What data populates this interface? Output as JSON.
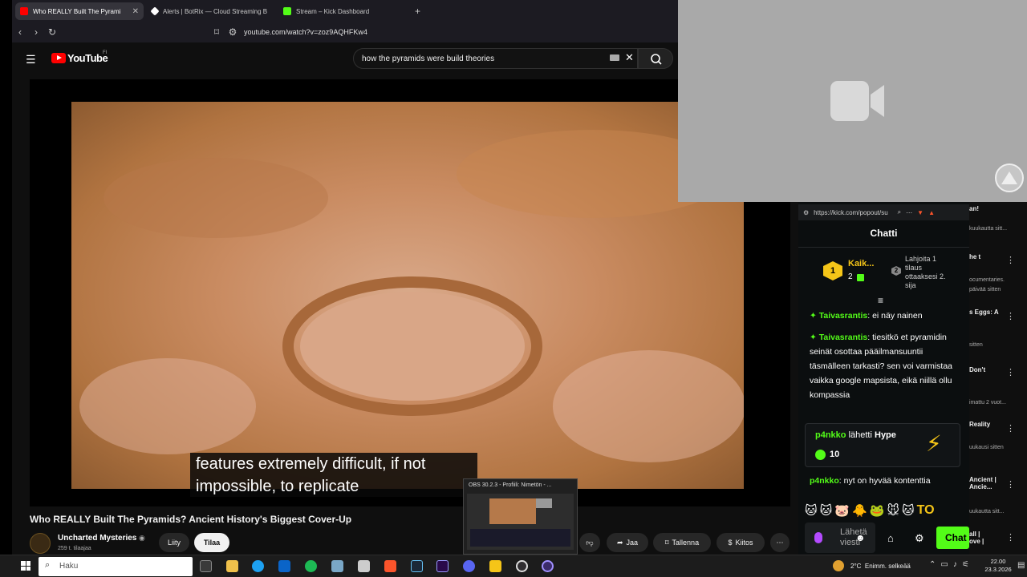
{
  "browser": {
    "tabs": [
      {
        "label": "Who REALLY Built The Pyrami",
        "active": true,
        "color": "#ff0000"
      },
      {
        "label": "Alerts | BotRix — Cloud Streaming B",
        "active": false,
        "color": "#ffffff"
      },
      {
        "label": "Stream – Kick Dashboard",
        "active": false,
        "color": "#53fc18"
      }
    ],
    "new_tab": "+",
    "url": "youtube.com/watch?v=zoz9AQHFKw4"
  },
  "youtube": {
    "logo": "YouTube",
    "region": "FI",
    "search_value": "how the pyramids were build theories",
    "caption_line1": "features extremely difficult, if not",
    "caption_line2": "impossible, to replicate",
    "video_title": "Who REALLY Built The Pyramids? Ancient History's Biggest Cover-Up",
    "channel_name": "Uncharted Mysteries",
    "subscribers": "259 t. tilaajaa",
    "join_label": "Liity",
    "subscribe_label": "Tilaa",
    "share_label": "Jaa",
    "save_label": "Tallenna",
    "thanks_label": "Kiitos",
    "more_label": "⋯"
  },
  "kick": {
    "url": "https://kick.com/popout/su",
    "title": "Chatti",
    "leader_name": "Kaik...",
    "leader_count": "2",
    "leader_rank": "1",
    "gift_rank": "2",
    "gift_text": "Lahjoita 1 tilaus ottaaksesi 2. sija",
    "messages": [
      {
        "user": "Taivasrantis",
        "text": "ei näy nainen"
      },
      {
        "user": "Taivasrantis",
        "text": "tiesitkö et pyramidin seinät osottaa pääilmansuuntii täsmälleen tarkasti? sen voi varmistaa vaikka google mapsista, eikä niillä ollu kompassia"
      }
    ],
    "hype_user": "p4nkko",
    "hype_sent": "lähetti",
    "hype_word": "Hype",
    "hype_amount": "10",
    "last_user": "p4nkko",
    "last_text": "nyt on hyvää kontenttia",
    "emote_text": "TO",
    "input_placeholder": "Lähetä viesti",
    "chat_button": "Chat"
  },
  "right_column": [
    {
      "title": "an!",
      "meta": "kuukautta sitt..."
    },
    {
      "title": "he t",
      "meta": "ocumentaries."
    },
    {
      "title": "",
      "meta": "päivää sitten"
    },
    {
      "title": "s Eggs: A",
      "meta": ""
    },
    {
      "title": "",
      "meta": "sitten"
    },
    {
      "title": "Don't",
      "meta": ""
    },
    {
      "title": "",
      "meta": "imattu 2 vuot..."
    },
    {
      "title": "Reality",
      "meta": ""
    },
    {
      "title": "",
      "meta": "uukausi sitten"
    },
    {
      "title": "Ancient | Ancie...",
      "meta": ""
    },
    {
      "title": "",
      "meta": "uukautta sitt..."
    },
    {
      "title": "all | ove |",
      "meta": ""
    }
  ],
  "obs": {
    "title": "OBS 30.2.3 - Profiili: Nimetön - ..."
  },
  "taskbar": {
    "search_placeholder": "Haku",
    "weather": "2°C  Enimm. selkeää",
    "time": "22.00",
    "date": "23.3.2026"
  },
  "colors": {
    "yt_red": "#ff0000",
    "kick_green": "#53fc18",
    "gold": "#f5c518"
  }
}
